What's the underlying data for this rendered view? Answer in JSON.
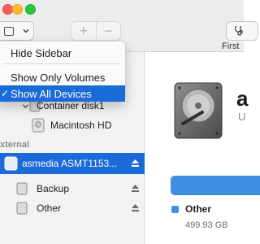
{
  "menu": {
    "items": [
      {
        "label": "Hide Sidebar"
      },
      {
        "label": "Show Only Volumes"
      },
      {
        "label": "Show All Devices"
      }
    ]
  },
  "toolbar": {
    "add_symbol": "+",
    "remove_symbol": "−",
    "first_aid_label": "First"
  },
  "sidebar": {
    "container_label": "Container disk1",
    "macintosh_label": "Macintosh HD",
    "external_header": "xternal",
    "external_device_label": "asmedia ASMT1153...",
    "backup_label": "Backup",
    "other_label": "Other"
  },
  "detail": {
    "title_partial": "a",
    "subtitle_partial": "U",
    "legend_label": "Other",
    "legend_size": "499.93 GB",
    "accent_color": "#3d8fe3"
  }
}
